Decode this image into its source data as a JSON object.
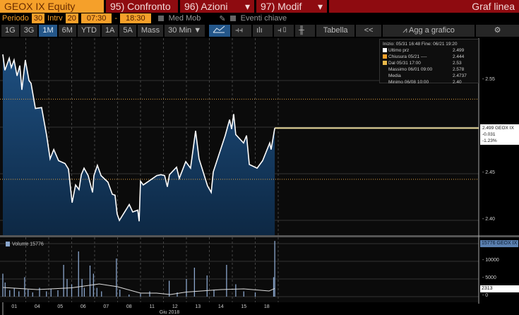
{
  "header": {
    "ticker": "GEOX IX Equity",
    "compare": "95) Confronto",
    "actions": "96) Azioni",
    "modify": "97) Modif",
    "chart_type": "Graf linea",
    "dropdown_arrow": "▾"
  },
  "settings": {
    "period_label": "Periodo",
    "period": "30",
    "interval_label": "Intrv",
    "interval": "20",
    "start": "07:30",
    "dash": "-",
    "end": "18:30",
    "moving_avg": "Med Mob",
    "key_events": "Eventi chiave"
  },
  "toolbar": {
    "ranges": [
      "1G",
      "3G",
      "1M",
      "6M",
      "YTD",
      "1A",
      "5A",
      "Mass"
    ],
    "active_range": "1M",
    "bar_size": "30 Min ▼",
    "table": "Tabella",
    "collapse": "<<",
    "add_to_chart": "Agg a grafico"
  },
  "legend": {
    "range": "Inizio: 05/31 16:48 Fine: 06/21 19:20",
    "rows": [
      {
        "label": "Ultimo prz",
        "value": "2.499",
        "color": "#ffffff"
      },
      {
        "label": "Chiusura 05/21 ----",
        "value": "2.444",
        "color": "#f5a02a"
      },
      {
        "label": "Dal 05/31 17:00",
        "value": "2.53",
        "color": "#e8b84a"
      },
      {
        "label": "Massimo 06/01 09:00",
        "value": "2.578"
      },
      {
        "label": "Media",
        "value": "2.4737"
      },
      {
        "label": "Minimo 06/08 10:00",
        "value": "2.40"
      }
    ]
  },
  "price_label": {
    "line1": "2.499 GEOX IX",
    "line2": "-0.031",
    "line3": "-1.23%"
  },
  "volume": {
    "legend": "Volume 15776",
    "last_label": "15776 GEOX IX",
    "ma_label": "2313"
  },
  "colors": {
    "line": "#ffffff",
    "fill": "#1b4673",
    "last": "#e8d89a",
    "ref": "#e0a040",
    "vol": "#8aa6cc"
  },
  "chart_data": {
    "type": "line",
    "title": "GEOX IX Equity",
    "xlabel": "Giu 2018",
    "x_ticks": [
      "01",
      "04",
      "05",
      "06",
      "07",
      "08",
      "11",
      "12",
      "13",
      "14",
      "15",
      "18"
    ],
    "price_ticks": [
      "2.55",
      "2.45",
      "2.40"
    ],
    "price_tick_values": [
      2.55,
      2.45,
      2.4
    ],
    "ylim": [
      2.38,
      2.6
    ],
    "reference_lines": {
      "close_05_21": 2.444,
      "from_05_31": 2.53,
      "last": 2.499
    },
    "price_series": [
      [
        0,
        2.578
      ],
      [
        0.09,
        2.561
      ],
      [
        0.28,
        2.574
      ],
      [
        0.37,
        2.564
      ],
      [
        0.49,
        2.572
      ],
      [
        0.62,
        2.555
      ],
      [
        0.74,
        2.566
      ],
      [
        0.83,
        2.54
      ],
      [
        0.98,
        2.572
      ],
      [
        1.14,
        2.55
      ],
      [
        1.23,
        2.547
      ],
      [
        1.42,
        2.52
      ],
      [
        1.69,
        2.521
      ],
      [
        1.91,
        2.491
      ],
      [
        2.06,
        2.466
      ],
      [
        2.22,
        2.476
      ],
      [
        2.43,
        2.464
      ],
      [
        2.71,
        2.461
      ],
      [
        2.86,
        2.455
      ],
      [
        3.02,
        2.419
      ],
      [
        3.17,
        2.438
      ],
      [
        3.32,
        2.433
      ],
      [
        3.42,
        2.449
      ],
      [
        3.54,
        2.456
      ],
      [
        3.72,
        2.448
      ],
      [
        3.91,
        2.43
      ],
      [
        3.97,
        2.448
      ],
      [
        4.12,
        2.459
      ],
      [
        4.28,
        2.448
      ],
      [
        4.58,
        2.441
      ],
      [
        4.77,
        2.428
      ],
      [
        4.89,
        2.427
      ],
      [
        4.98,
        2.407
      ],
      [
        5.08,
        2.4
      ],
      [
        5.51,
        2.417
      ],
      [
        5.66,
        2.409
      ],
      [
        5.88,
        2.411
      ],
      [
        5.94,
        2.399
      ],
      [
        6.0,
        2.442
      ],
      [
        6.12,
        2.438
      ],
      [
        6.71,
        2.448
      ],
      [
        6.89,
        2.449
      ],
      [
        7.05,
        2.448
      ],
      [
        7.17,
        2.436
      ],
      [
        7.26,
        2.449
      ],
      [
        7.57,
        2.457
      ],
      [
        7.69,
        2.445
      ],
      [
        7.97,
        2.463
      ],
      [
        8.18,
        2.456
      ],
      [
        8.4,
        2.496
      ],
      [
        8.55,
        2.466
      ],
      [
        8.92,
        2.437
      ],
      [
        9.08,
        2.43
      ],
      [
        9.17,
        2.452
      ],
      [
        9.69,
        2.491
      ],
      [
        9.88,
        2.508
      ],
      [
        9.97,
        2.498
      ],
      [
        10.06,
        2.514
      ],
      [
        10.15,
        2.492
      ],
      [
        10.49,
        2.483
      ],
      [
        10.62,
        2.491
      ],
      [
        10.74,
        2.46
      ],
      [
        11.08,
        2.456
      ],
      [
        11.32,
        2.464
      ],
      [
        11.63,
        2.483
      ],
      [
        11.69,
        2.476
      ],
      [
        11.85,
        2.499
      ]
    ],
    "volume_ticks": [
      "10000",
      "5000",
      "0"
    ],
    "volume_tick_values": [
      10000,
      5000,
      0
    ],
    "volume_series": [
      [
        0,
        6500
      ],
      [
        0.1,
        4000
      ],
      [
        0.3,
        1800
      ],
      [
        0.5,
        2500
      ],
      [
        0.7,
        1500
      ],
      [
        0.95,
        5500
      ],
      [
        1.1,
        2000
      ],
      [
        1.3,
        1200
      ],
      [
        1.6,
        2500
      ],
      [
        1.9,
        1500
      ],
      [
        2.1,
        2200
      ],
      [
        2.4,
        1800
      ],
      [
        2.65,
        9000
      ],
      [
        2.8,
        5000
      ],
      [
        3.0,
        3500
      ],
      [
        3.3,
        12800
      ],
      [
        3.45,
        5000
      ],
      [
        3.55,
        2500
      ],
      [
        3.8,
        8800
      ],
      [
        3.95,
        6500
      ],
      [
        4.1,
        2500
      ],
      [
        4.3,
        1500
      ],
      [
        4.95,
        10800
      ],
      [
        5.1,
        2000
      ],
      [
        5.5,
        600
      ],
      [
        6.0,
        800
      ],
      [
        6.4,
        1500
      ],
      [
        7.25,
        4500
      ],
      [
        7.6,
        1200
      ],
      [
        8.0,
        5000
      ],
      [
        8.35,
        8200
      ],
      [
        8.9,
        6000
      ],
      [
        9.2,
        2000
      ],
      [
        9.75,
        9000
      ],
      [
        10.15,
        3500
      ],
      [
        10.5,
        1500
      ],
      [
        11.0,
        1200
      ],
      [
        11.8,
        5500
      ],
      [
        11.85,
        15776
      ]
    ],
    "volume_ma": [
      [
        0,
        2600
      ],
      [
        1.5,
        2000
      ],
      [
        3.0,
        2500
      ],
      [
        4.2,
        3600
      ],
      [
        5.0,
        2800
      ],
      [
        6.0,
        1000
      ],
      [
        6.7,
        1000
      ],
      [
        7.3,
        600
      ],
      [
        8.0,
        1300
      ],
      [
        9.5,
        2000
      ],
      [
        10.5,
        2200
      ],
      [
        11.6,
        1600
      ],
      [
        11.85,
        2313
      ]
    ]
  }
}
